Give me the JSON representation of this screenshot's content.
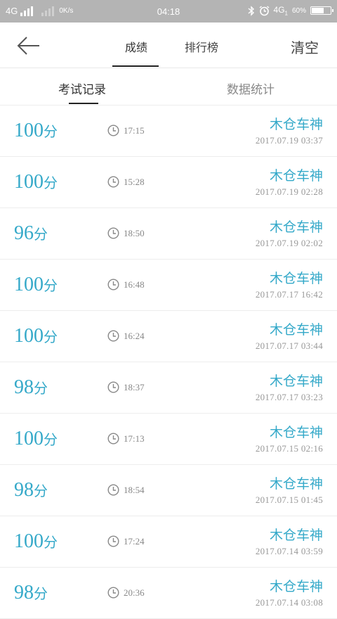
{
  "status_bar": {
    "network": "4G",
    "speed": "0K/s",
    "time": "04:18",
    "network2": "4G",
    "sim": "1",
    "battery": "60%"
  },
  "header": {
    "tabs": [
      "成绩",
      "排行榜"
    ],
    "clear_label": "清空"
  },
  "subtabs": {
    "exam_records": "考试记录",
    "data_stats": "数据统计"
  },
  "records": [
    {
      "score": "100",
      "unit": "分",
      "duration": "17:15",
      "name": "木仓车神",
      "date": "2017.07.19  03:37"
    },
    {
      "score": "100",
      "unit": "分",
      "duration": "15:28",
      "name": "木仓车神",
      "date": "2017.07.19  02:28"
    },
    {
      "score": "96",
      "unit": "分",
      "duration": "18:50",
      "name": "木仓车神",
      "date": "2017.07.19  02:02"
    },
    {
      "score": "100",
      "unit": "分",
      "duration": "16:48",
      "name": "木仓车神",
      "date": "2017.07.17  16:42"
    },
    {
      "score": "100",
      "unit": "分",
      "duration": "16:24",
      "name": "木仓车神",
      "date": "2017.07.17  03:44"
    },
    {
      "score": "98",
      "unit": "分",
      "duration": "18:37",
      "name": "木仓车神",
      "date": "2017.07.17  03:23"
    },
    {
      "score": "100",
      "unit": "分",
      "duration": "17:13",
      "name": "木仓车神",
      "date": "2017.07.15  02:16"
    },
    {
      "score": "98",
      "unit": "分",
      "duration": "18:54",
      "name": "木仓车神",
      "date": "2017.07.15  01:45"
    },
    {
      "score": "100",
      "unit": "分",
      "duration": "17:24",
      "name": "木仓车神",
      "date": "2017.07.14  03:59"
    },
    {
      "score": "98",
      "unit": "分",
      "duration": "20:36",
      "name": "木仓车神",
      "date": "2017.07.14  03:08"
    }
  ]
}
